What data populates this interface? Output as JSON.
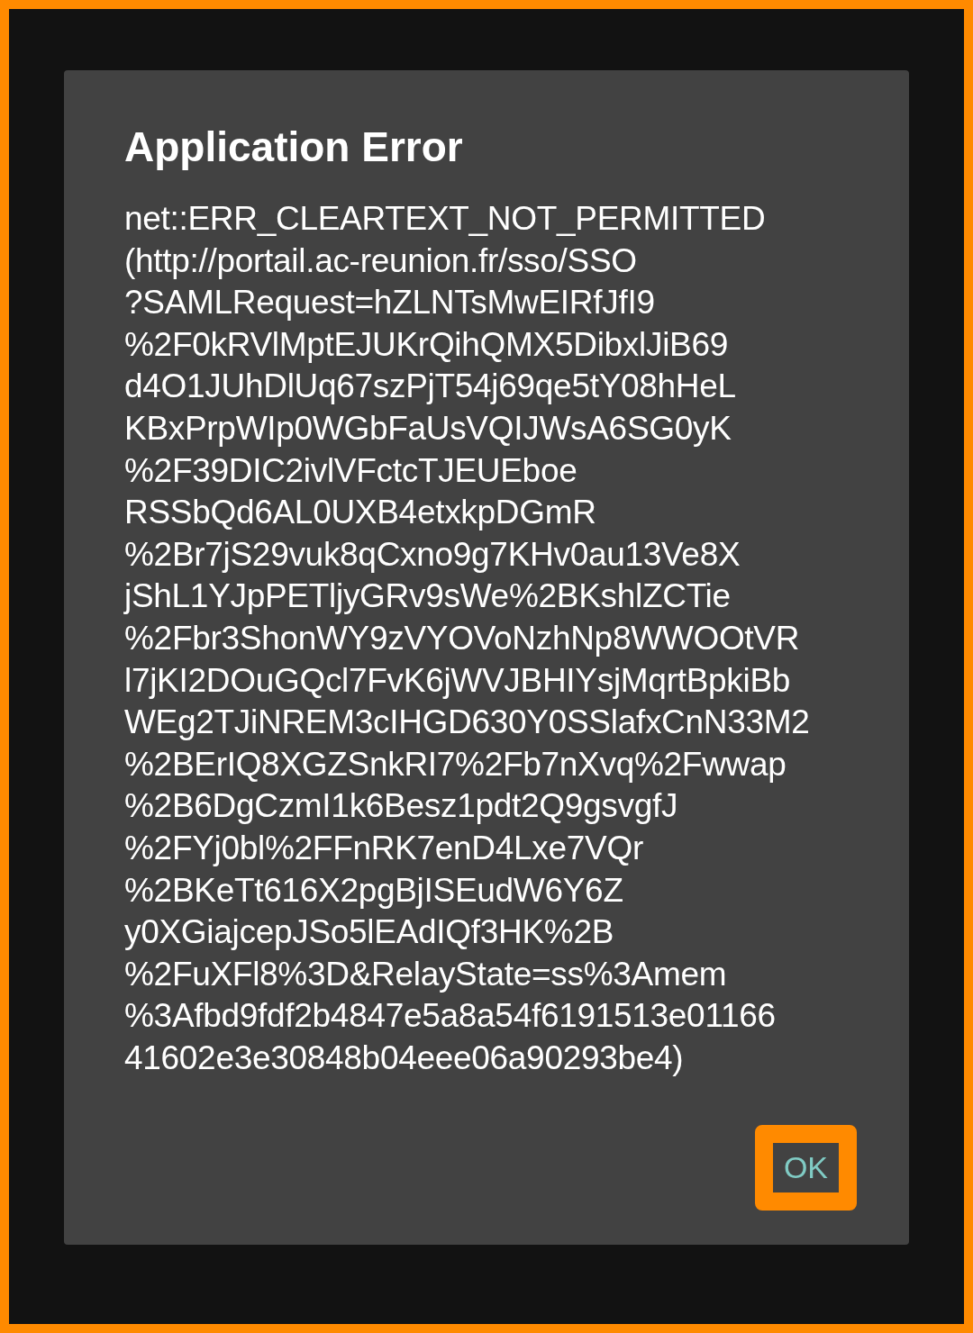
{
  "dialog": {
    "title": "Application Error",
    "message_lines": [
      "net::ERR_CLEARTEXT_NOT_PERMITTED",
      "(http://portail.ac-reunion.fr/sso/SSO",
      "?SAMLRequest=hZLNTsMwEIRfJfI9",
      "%2F0kRVlMptEJUKrQihQMX5DibxlJiB69",
      "d4O1JUhDlUq67szPjT54j69qe5tY08hHeL",
      "KBxPrpWIp0WGbFaUsVQIJWsA6SG0yK",
      "%2F39DIC2ivlVFctcTJEUEboe",
      "RSSbQd6AL0UXB4etxkpDGmR",
      "%2Br7jS29vuk8qCxno9g7KHv0au13Ve8X",
      "jShL1YJpPETljyGRv9sWe%2BKshlZCTie",
      "%2Fbr3ShonWY9zVYOVoNzhNp8WWOOtVR",
      "l7jKI2DOuGQcl7FvK6jWVJBHIYsjMqrtBpkiBb",
      "WEg2TJiNREM3cIHGD630Y0SSlafxCnN33M2",
      "%2BErIQ8XGZSnkRI7%2Fb7nXvq%2Fwwap",
      "%2B6DgCzmI1k6Besz1pdt2Q9gsvgfJ",
      "%2FYj0bl%2FFnRK7enD4Lxe7VQr",
      "%2BKeTt616X2pgBjISEudW6Y6Z",
      "y0XGiajcepJSo5lEAdIQf3HK%2B",
      "%2FuXFl8%3D&RelayState=ss%3Amem",
      "%3Afbd9fdf2b4847e5a8a54f6191513e01166",
      "41602e3e30848b04eee06a90293be4)"
    ],
    "buttons": [
      {
        "label": "OK",
        "highlighted": true
      }
    ]
  }
}
